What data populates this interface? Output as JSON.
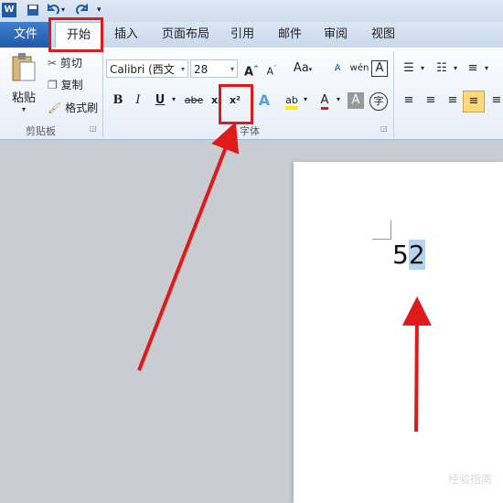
{
  "qat": {
    "word_icon": "word-logo-icon",
    "save": "save-icon",
    "undo": "undo-icon",
    "redo": "redo-icon",
    "customize": "▾"
  },
  "tabs": {
    "file": "文件",
    "home": "开始",
    "insert": "插入",
    "layout": "页面布局",
    "references": "引用",
    "mailings": "邮件",
    "review": "审阅",
    "view": "视图"
  },
  "clipboard": {
    "paste": "粘贴",
    "cut": "剪切",
    "copy": "复制",
    "format_painter": "格式刷",
    "group": "剪贴板"
  },
  "font": {
    "name": "Calibri (西文",
    "size": "28",
    "bold": "B",
    "italic": "I",
    "underline": "U",
    "strike": "abe",
    "subscript": "x₂",
    "superscript": "x²",
    "group": "字体",
    "change_case": "Aa"
  },
  "document": {
    "text_base": "5",
    "text_selected": "2"
  },
  "watermark": "经验指南",
  "colors": {
    "accent": "#e0191b",
    "ribbon_blue": "#1f5aa8",
    "selection": "#b7d3f2"
  }
}
